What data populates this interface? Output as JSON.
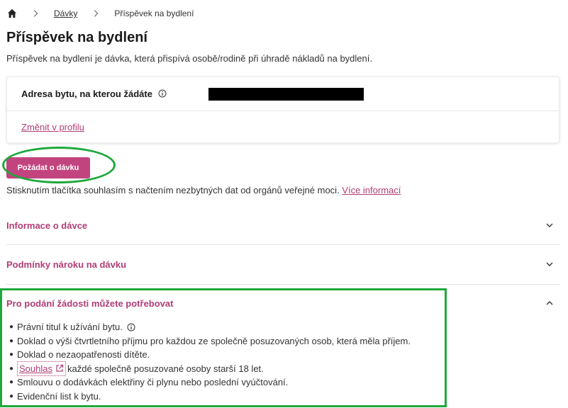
{
  "breadcrumb": {
    "home_icon": "home-icon",
    "link": "Dávky",
    "current": "Příspěvek na bydlení"
  },
  "page": {
    "title": "Příspěvek na bydlení",
    "description": "Příspěvek na bydlení je dávka, která přispívá osobě/rodině při úhradě nákladů na bydlení."
  },
  "address": {
    "label": "Adresa bytu, na kterou žádáte",
    "change_link": "Změnit v profilu"
  },
  "apply_button": "Požádat o dávku",
  "consent": {
    "text": "Stisknutím tlačítka souhlasím s načtením nezbytných dat od orgánů veřejné moci. ",
    "link": "Více informací"
  },
  "accordions": [
    {
      "title": "Informace o dávce",
      "expanded": false
    },
    {
      "title": "Podmínky nároku na dávku",
      "expanded": false
    },
    {
      "title": "Pro podání žádosti můžete potřebovat",
      "expanded": true
    }
  ],
  "requirements": {
    "item1": "Právní titul k užívání bytu.",
    "item2": "Doklad o výši čtvrtletního příjmu pro každou ze společně posuzovaných osob, která měla příjem.",
    "item3": "Doklad o nezaopatřenosti dítěte.",
    "item4_link": "Souhlas",
    "item4_rest": "každé společně posuzované osoby starší 18 let.",
    "item5": "Smlouvu o dodávkách elektřiny či plynu nebo poslední vyúčtování.",
    "item6": "Evidenční list k bytu."
  },
  "colors": {
    "accent": "#c2447f",
    "link": "#b03d75",
    "highlight": "#1fa83d"
  }
}
